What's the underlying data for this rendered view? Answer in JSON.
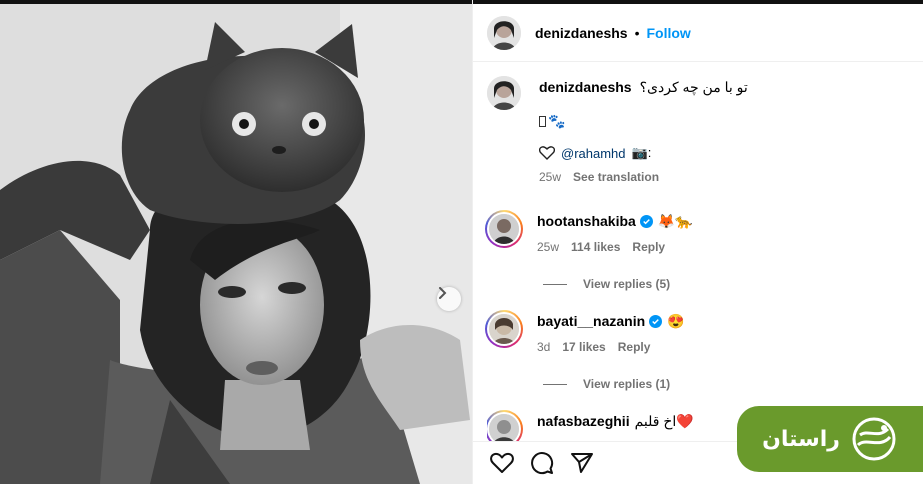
{
  "post": {
    "username": "denizdaneshs",
    "separator": "•",
    "follow_label": "Follow"
  },
  "caption": {
    "username": "denizdaneshs",
    "text": "تو با من چه کردی؟",
    "emoji_line": "🐾",
    "credit_camera": "📷:",
    "credit_mention": "@rahamhd",
    "time": "25w",
    "see_translation": "See translation"
  },
  "comments": [
    {
      "username": "hootanshakiba",
      "verified": true,
      "text": "🦊🐆",
      "time": "25w",
      "likes": "114 likes",
      "reply": "Reply",
      "view_replies": "View replies (5)"
    },
    {
      "username": "bayati__nazanin",
      "verified": true,
      "text": "😍",
      "time": "3d",
      "likes": "17 likes",
      "reply": "Reply",
      "view_replies": "View replies (1)"
    },
    {
      "username": "nafasbazeghii",
      "verified": false,
      "text": "❤️اخ قلبم"
    }
  ],
  "actions": {
    "like_icon": "heart-outline-icon",
    "comment_icon": "comment-bubble-icon",
    "share_icon": "paper-plane-icon"
  },
  "watermark": {
    "text": "راستان",
    "color": "#6a9a2c"
  },
  "colors": {
    "link_blue": "#0095f6",
    "meta_gray": "#737373",
    "verified_blue": "#0095f6"
  }
}
